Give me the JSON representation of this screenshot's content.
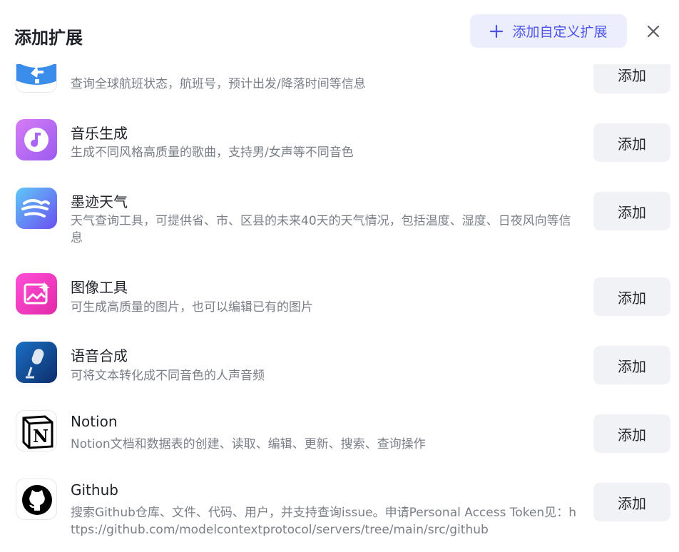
{
  "header": {
    "title": "添加扩展",
    "add_custom_label": "添加自定义扩展",
    "accent_color": "#4d53e8"
  },
  "extensions": [
    {
      "name": "",
      "description": "查询全球航班状态，航班号，预计出发/降落时间等信息",
      "icon": "airplane-icon",
      "button": "添加"
    },
    {
      "name": "音乐生成",
      "description": "生成不同风格高质量的歌曲，支持男/女声等不同音色",
      "icon": "music-note-icon",
      "button": "添加"
    },
    {
      "name": "墨迹天气",
      "description": "天气查询工具，可提供省、市、区县的未来40天的天气情况，包括温度、湿度、日夜风向等信息",
      "icon": "weather-wind-icon",
      "button": "添加"
    },
    {
      "name": "图像工具",
      "description": "可生成高质量的图片，也可以编辑已有的图片",
      "icon": "image-sparkle-icon",
      "button": "添加"
    },
    {
      "name": "语音合成",
      "description": "可将文本转化成不同音色的人声音频",
      "icon": "microphone-icon",
      "button": "添加"
    },
    {
      "name": "Notion",
      "description": "Notion文档和数据表的创建、读取、编辑、更新、搜索、查询操作",
      "icon": "notion-logo-icon",
      "button": "添加"
    },
    {
      "name": "Github",
      "description": "搜索Github仓库、文件、代码、用户，并支持查询issue。申请Personal Access Token见：https://github.com/modelcontextprotocol/servers/tree/main/src/github",
      "icon": "github-logo-icon",
      "button": "添加"
    }
  ]
}
